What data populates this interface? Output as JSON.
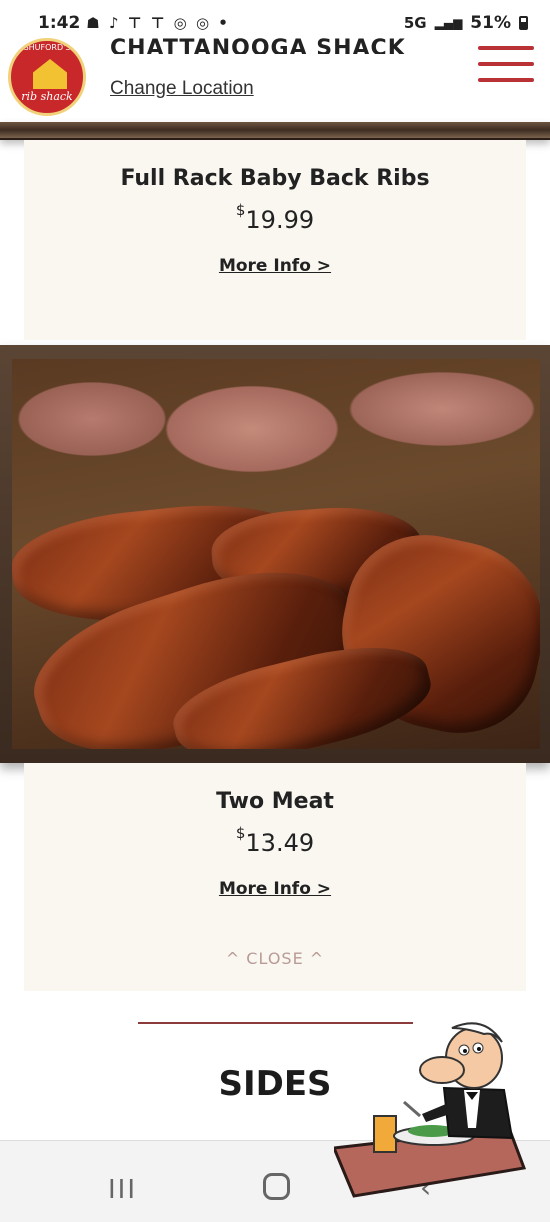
{
  "status_bar": {
    "time": "1:42",
    "notification_icons": "☗ ♪ ⊤ ⊤ ◎ ◎ •",
    "network": "5G",
    "battery": "51%"
  },
  "header": {
    "logo_top_text": "SHUFORD'S",
    "logo_bottom_text": "rib shack",
    "store_name": "CHATTANOOGA SHACK",
    "change_location": "Change Location"
  },
  "items": [
    {
      "title": "Full Rack Baby Back Ribs",
      "currency": "$",
      "price": "19.99",
      "more_info": "More Info >"
    },
    {
      "title": "Two Meat",
      "currency": "$",
      "price": "13.49",
      "more_info": "More Info >"
    }
  ],
  "close_label": "^ CLOSE ^",
  "section_title": "SIDES",
  "nav": {
    "recent": "III",
    "back": "‹"
  },
  "colors": {
    "accent": "#b83236",
    "card_bg": "#faf7f1",
    "frame": "#4a3628"
  }
}
